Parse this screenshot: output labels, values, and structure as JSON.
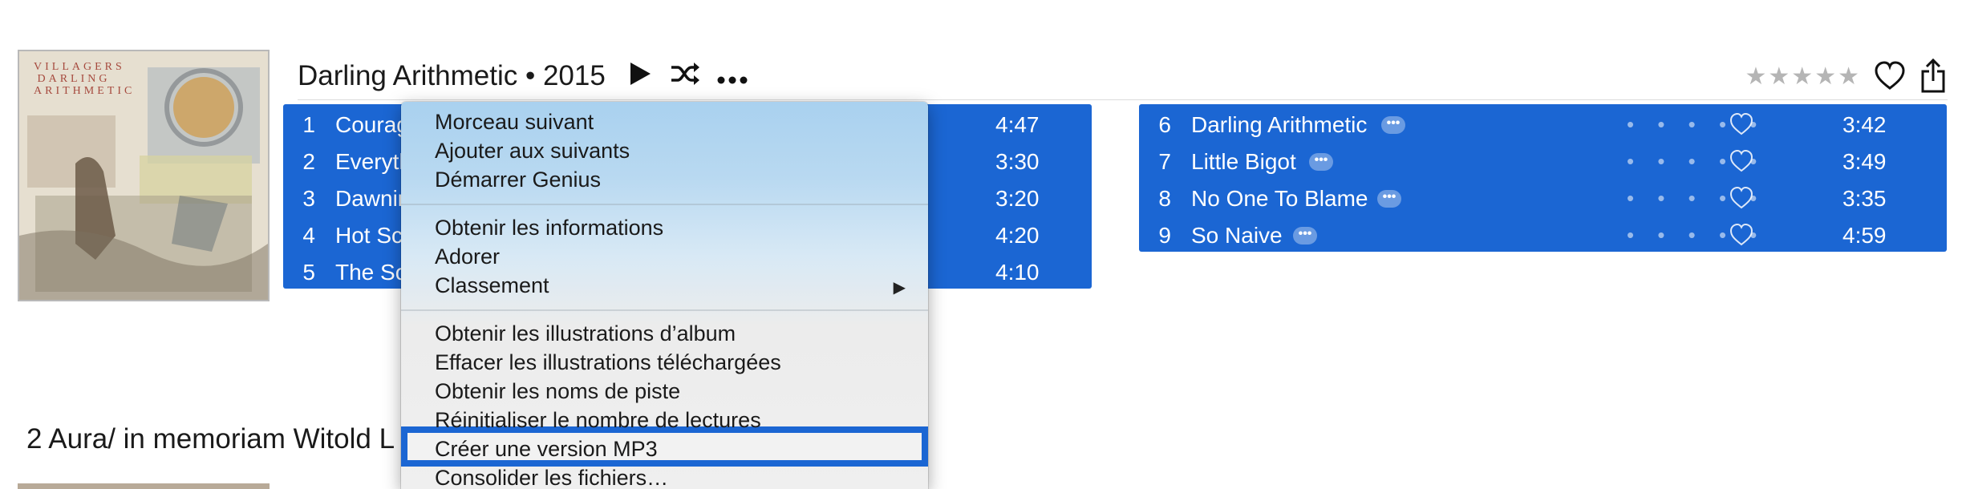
{
  "album": {
    "header": "Darling Arithmetic • 2015",
    "artwork": {
      "cover_lines": [
        "VILLAGERS",
        "DARLING",
        "ARITHMETIC"
      ]
    },
    "controls": {
      "play_icon": "play-icon",
      "shuffle_icon": "shuffle-icon",
      "more_icon": "more-icon",
      "rating_icon": "rating-stars-icon",
      "love_icon": "heart-icon",
      "share_icon": "share-icon"
    },
    "rating_display": "★★★★★"
  },
  "tracks_left": [
    {
      "num": "1",
      "title": "Courag",
      "time": "4:47"
    },
    {
      "num": "2",
      "title": "Everyth",
      "time": "3:30"
    },
    {
      "num": "3",
      "title": "Dawnir",
      "time": "3:20"
    },
    {
      "num": "4",
      "title": "Hot Sc",
      "time": "4:20"
    },
    {
      "num": "5",
      "title": "The Sc",
      "time": "4:10"
    }
  ],
  "tracks_right": [
    {
      "num": "6",
      "title": "Darling Arithmetic",
      "time": "3:42"
    },
    {
      "num": "7",
      "title": "Little Bigot",
      "time": "3:49"
    },
    {
      "num": "8",
      "title": "No One To Blame",
      "time": "3:35"
    },
    {
      "num": "9",
      "title": "So Naive",
      "time": "4:59"
    }
  ],
  "row_more_label": "•••",
  "row_rating_dots": "• • • • •",
  "context_menu": {
    "items": [
      {
        "label": "Morceau suivant"
      },
      {
        "label": "Ajouter aux suivants"
      },
      {
        "label": "Démarrer Genius"
      },
      {
        "label": "Obtenir les informations"
      },
      {
        "label": "Adorer"
      },
      {
        "label": "Classement"
      },
      {
        "label": "Obtenir les illustrations d’album"
      },
      {
        "label": "Effacer les illustrations téléchargées"
      },
      {
        "label": "Obtenir les noms de piste"
      },
      {
        "label": "Réinitialiser le nombre de lectures"
      },
      {
        "label": "Créer une version MP3"
      },
      {
        "label": "Consolider les fichiers…"
      }
    ],
    "submenu_arrow": "▶",
    "highlighted_label": "Créer une version MP3"
  },
  "next_section": {
    "title": "2 Aura/ in memoriam Witold L"
  }
}
